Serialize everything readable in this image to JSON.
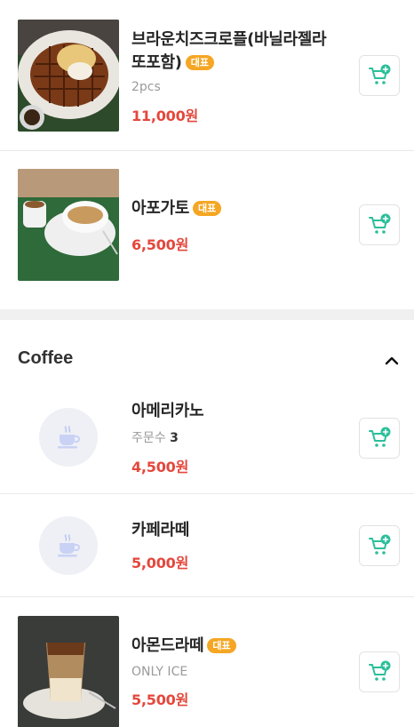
{
  "colors": {
    "price": "#e4473c",
    "badge": "#f5a623",
    "cart_icon": "#2bbf9a",
    "section_gap": "#f0f0f0"
  },
  "menu_top": [
    {
      "name_line1": "브라운치즈크로플(바닐라젤라",
      "name_line2": "또포함)",
      "badge": "대표",
      "sub": "2pcs",
      "price": "11,000원",
      "image": "waffle-photo"
    },
    {
      "name": "아포가토",
      "badge": "대표",
      "price": "6,500원",
      "image": "affogato-photo"
    }
  ],
  "section": {
    "title": "Coffee",
    "toggle_icon": "chevron-up-icon"
  },
  "coffee_items": [
    {
      "name": "아메리카노",
      "sub_label": "주문수",
      "sub_value": "3",
      "price": "4,500원",
      "image": "coffee-cup-placeholder"
    },
    {
      "name": "카페라떼",
      "price": "5,000원",
      "image": "coffee-cup-placeholder"
    },
    {
      "name": "아몬드라떼",
      "badge": "대표",
      "sub": "ONLY ICE",
      "price": "5,500원",
      "image": "iced-latte-photo"
    }
  ],
  "cart_icon": "cart-plus-icon"
}
